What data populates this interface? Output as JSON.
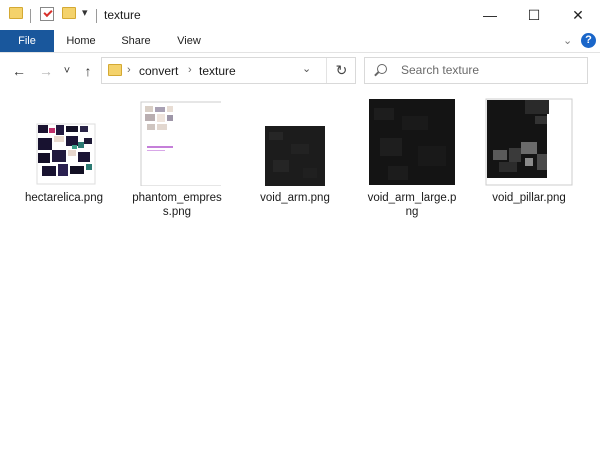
{
  "window": {
    "title": "texture",
    "controls": {
      "minimize": "—",
      "maximize": "☐",
      "close": "✕"
    }
  },
  "quick_access": {
    "dropdown": "▾"
  },
  "ribbon": {
    "tabs": [
      {
        "label": "File",
        "active": true
      },
      {
        "label": "Home"
      },
      {
        "label": "Share"
      },
      {
        "label": "View"
      }
    ],
    "collapse_icon": "chevron-down-icon",
    "help_label": "?"
  },
  "navigation": {
    "back": "←",
    "forward": "→",
    "recent": "˅",
    "up": "↑",
    "breadcrumbs": [
      "convert",
      "texture"
    ],
    "separator": "›",
    "dropdown": "⌄",
    "refresh": "↻"
  },
  "search": {
    "placeholder": "Search texture"
  },
  "files": [
    {
      "name": "hectarelica.png",
      "thumbnail": "sprite-sheet-dark"
    },
    {
      "name": "phantom_empress.png",
      "thumbnail": "sprite-sheet-light"
    },
    {
      "name": "void_arm.png",
      "thumbnail": "dark-texture-small"
    },
    {
      "name": "void_arm_large.png",
      "thumbnail": "dark-texture-large"
    },
    {
      "name": "void_pillar.png",
      "thumbnail": "dark-texture-blocks"
    }
  ],
  "colors": {
    "file_tab": "#19579c",
    "help": "#1a66c9",
    "folder": "#f4d26b"
  }
}
